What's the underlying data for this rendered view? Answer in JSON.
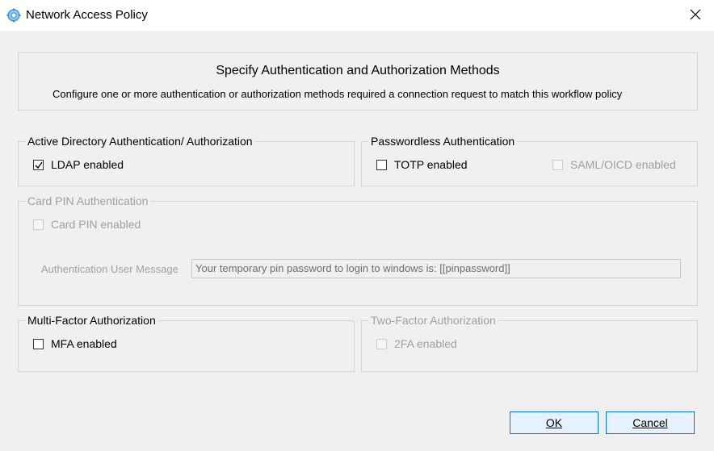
{
  "window": {
    "title": "Network Access Policy",
    "app_icon": "gear-icon",
    "close_icon": "close-icon"
  },
  "header": {
    "title": "Specify Authentication and Authorization Methods",
    "subtitle": "Configure one or more authentication or authorization methods required a connection request to match this workflow policy"
  },
  "groups": {
    "active_directory": {
      "legend": "Active Directory Authentication/ Authorization",
      "ldap": {
        "label": "LDAP enabled",
        "checked": true,
        "enabled": true
      }
    },
    "passwordless": {
      "legend": "Passwordless Authentication",
      "totp": {
        "label": "TOTP enabled",
        "checked": false,
        "enabled": true
      },
      "saml": {
        "label": "SAML/OICD enabled",
        "checked": false,
        "enabled": false
      }
    },
    "card_pin": {
      "legend": "Card PIN Authentication",
      "card_pin": {
        "label": "Card PIN enabled",
        "checked": false,
        "enabled": false
      },
      "message_label": "Authentication User Message",
      "message_value": "Your temporary pin password to login to windows is: [[pinpassword]]"
    },
    "mfa": {
      "legend": "Multi-Factor Authorization",
      "mfa": {
        "label": "MFA enabled",
        "checked": false,
        "enabled": true
      }
    },
    "two_factor": {
      "legend": "Two-Factor Authorization",
      "twofa": {
        "label": "2FA enabled",
        "checked": false,
        "enabled": false
      }
    }
  },
  "buttons": {
    "ok": "OK",
    "cancel": "Cancel"
  },
  "colors": {
    "accent": "#0078d7",
    "button_bg": "#e5f1fb",
    "disabled_text": "#a0a0a0",
    "window_bg": "#f0f0f0"
  }
}
